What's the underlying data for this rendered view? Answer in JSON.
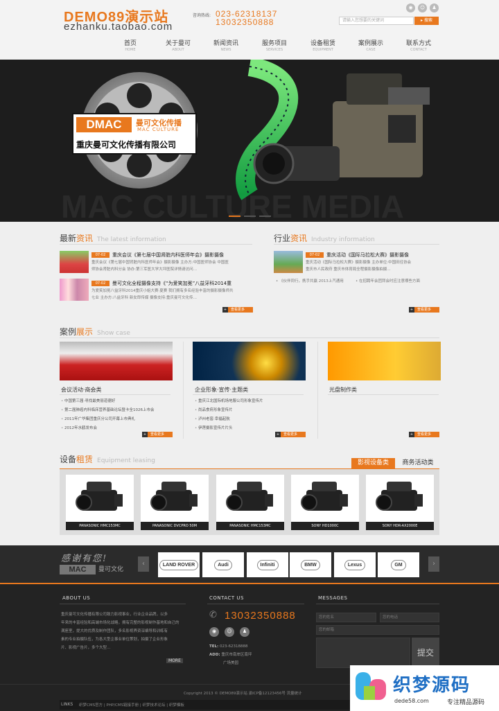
{
  "header": {
    "logo_line1": "DEMO89演示站",
    "logo_line2": "ezhanku.taobao.com",
    "hotline_label": "咨询热线:",
    "phone1": "023-62318137",
    "phone2": "13032350888",
    "search_placeholder": "请输入您想要的关键词",
    "search_button": "搜索",
    "nav": [
      {
        "cn": "首页",
        "en": "HOME"
      },
      {
        "cn": "关于曼可",
        "en": "ABOUT"
      },
      {
        "cn": "新闻资讯",
        "en": "NEWS"
      },
      {
        "cn": "服务项目",
        "en": "SERVICES"
      },
      {
        "cn": "设备租赁",
        "en": "EQUIPMENT"
      },
      {
        "cn": "案例展示",
        "en": "CASE"
      },
      {
        "cn": "联系方式",
        "en": "CONTACT"
      }
    ]
  },
  "banner": {
    "logo_mark": "DMAC",
    "brand_cn": "曼可文化传播",
    "brand_en": "MAC CULTURE",
    "company": "重庆曼可文化传播有限公司",
    "watermark": "MAC CULTURE MEDIA"
  },
  "news": {
    "title_a": "最新",
    "title_hl": "资讯",
    "title_en": "The latest information",
    "items": [
      {
        "date": "07-02",
        "title": "重庆会议《第七届中国肾脏内科医师年会》摄影摄像",
        "desc1": "重庆会议《第七届中国肾脏内科医师年会》摄影摄像 主办方:中国医师协会 中国医",
        "desc2": "师协会肾脏内科分会 协办:第三军医大学大坪医院详情请访问…"
      },
      {
        "date": "07-02",
        "title": "曼可文化全程摄像支持《“为爱笑加冕”八益牙科2014重",
        "desc1": "为爱笑加冕八益牙科2014重庆小姐大赛·夏赛 我们拥有多名经验丰富的摄影摄像师共",
        "desc2": "七业 主办方:八益牙科 新女郎传媒 摄像支持:重庆曼可文化传…"
      }
    ],
    "more": "查看更多"
  },
  "industry": {
    "title_a": "行业",
    "title_hl": "资讯",
    "title_en": "Industry information",
    "item": {
      "date": "07-02",
      "title": "重庆活动《国际马拉松大赛》摄影摄像",
      "desc1": "重庆活动《国际马拉松大赛》摄影摄像 主办单位:中国田径协会",
      "desc2": "重庆市人民政府 重庆市体育局全程摄影摄像拍摄…"
    },
    "links": [
      "《伙伴同行，携手共赢 2013上汽通用",
      "在招聘年会团拜会时应注意哪些方面"
    ],
    "more": "查看更多"
  },
  "cases": {
    "title_a": "案例",
    "title_hl": "展示",
    "title_en": "Show case",
    "columns": [
      {
        "title": "会议活动·商会类",
        "items": [
          "中国第三届·寻找最美丽道德好",
          "第二届肺癌内科临床营养基础论坛暨卡全1026上市会",
          "2011年广华集团重庆分公司开幕上市典礼",
          "2012年水鹤发布会"
        ],
        "more": "查看更多"
      },
      {
        "title": "企业形象·宣传·主题类",
        "items": [
          "重庆江北国际机场地服公司形象宣传片",
          "尚品食府形象宣传片",
          "泸州老窖·幸福起航",
          "伊莲摄影宣传片片头"
        ],
        "more": "查看更多"
      },
      {
        "title": "光盘制作类",
        "items": [],
        "more": "查看更多"
      }
    ]
  },
  "equipment": {
    "title_a": "设备",
    "title_hl": "租赁",
    "title_en": "Equipment leasing",
    "tabs": [
      "影视设备类",
      "商务活动类"
    ],
    "items": [
      "PANASONIC HMC153MC",
      "PANASONIC DVCPRO 50M",
      "PANASONIC HMC153MC",
      "SONY HD1000C",
      "SONY HDR-AX2000E"
    ]
  },
  "partners": {
    "thanks": "感谢有您!",
    "brand": "MAC",
    "brand_cn": "曼可文化",
    "brands": [
      "LAND ROVER",
      "Audi",
      "Infiniti",
      "BMW",
      "Lexus",
      "GM"
    ]
  },
  "footer": {
    "about_h": "ABOUT US",
    "about_lines": [
      "重庆曼可文化传播有限公司致力影视事业，行业企业品牌，以多",
      "年来的丰富经验和高端市场化战略，拥有完整的影视制作基地和自己的",
      "满座室，提大的优质及制作团队，多名影视界资深编导和训练有",
      "素的专业拍摄队伍，为各大型企事业单位策划，拍摄了企业形象",
      "片、影视广告片，多个大型…"
    ],
    "about_hl": "曼可文化",
    "about_more": "MORE",
    "contact_h": "CONTACT US",
    "contact_phone": "13032350888",
    "tel_label": "TEL:",
    "tel": "023-62318888",
    "addr_label": "ADD:",
    "addr1": "重庆市南岸区南坪",
    "addr2": "广场美园",
    "msg_h": "MESSAGES",
    "msg_name": "您的姓名",
    "msg_phone": "您的电话",
    "msg_email": "您的邮箱",
    "msg_submit": "提交",
    "copyright": "Copyright 2013 © DEMO89演示站   渝ICP备12123456号   流量统计",
    "links_label": "LINKS",
    "links": "织梦CMS官方 | PHP/CMS链接手册 | 织梦技术论坛 | 织梦模板",
    "wm_cn": "织梦源码",
    "wm_url": "dede58.com",
    "wm_slogan": "专注精品源码"
  }
}
